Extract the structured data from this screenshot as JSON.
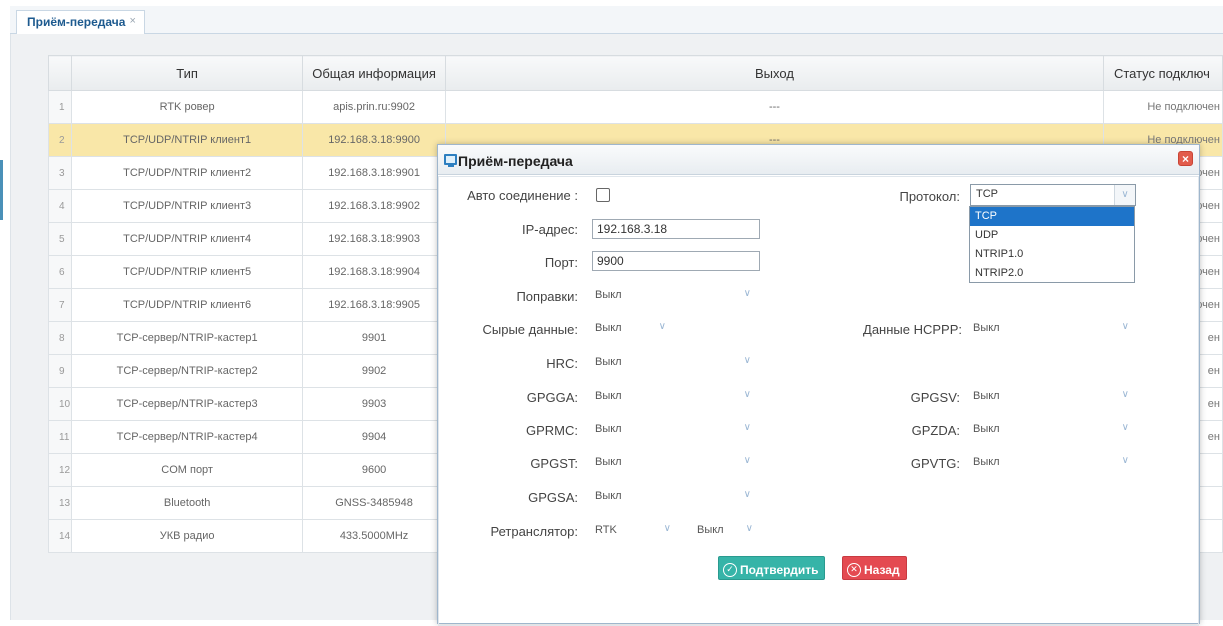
{
  "tab": {
    "label": "Приём-передача",
    "close": "×"
  },
  "table": {
    "headers": [
      "",
      "Тип",
      "Общая информация",
      "Выход",
      "Статус подключ"
    ],
    "rows": [
      {
        "num": "1",
        "type": "RTK ровер",
        "info": "apis.prin.ru:9902",
        "out": "---",
        "status": "Не подключен"
      },
      {
        "num": "2",
        "type": "TCP/UDP/NTRIP клиент1",
        "info": "192.168.3.18:9900",
        "out": "---",
        "status": "Не подключен"
      },
      {
        "num": "3",
        "type": "TCP/UDP/NTRIP клиент2",
        "info": "192.168.3.18:9901",
        "out": "",
        "status": "ючен"
      },
      {
        "num": "4",
        "type": "TCP/UDP/NTRIP клиент3",
        "info": "192.168.3.18:9902",
        "out": "",
        "status": "ючен"
      },
      {
        "num": "5",
        "type": "TCP/UDP/NTRIP клиент4",
        "info": "192.168.3.18:9903",
        "out": "",
        "status": "ючен"
      },
      {
        "num": "6",
        "type": "TCP/UDP/NTRIP клиент5",
        "info": "192.168.3.18:9904",
        "out": "",
        "status": "ючен"
      },
      {
        "num": "7",
        "type": "TCP/UDP/NTRIP клиент6",
        "info": "192.168.3.18:9905",
        "out": "",
        "status": "ючен"
      },
      {
        "num": "8",
        "type": "TCP-сервер/NTRIP-кастер1",
        "info": "9901",
        "out": "",
        "status": "ен"
      },
      {
        "num": "9",
        "type": "TCP-сервер/NTRIP-кастер2",
        "info": "9902",
        "out": "",
        "status": "ен"
      },
      {
        "num": "10",
        "type": "TCP-сервер/NTRIP-кастер3",
        "info": "9903",
        "out": "",
        "status": "ен"
      },
      {
        "num": "11",
        "type": "TCP-сервер/NTRIP-кастер4",
        "info": "9904",
        "out": "",
        "status": "ен"
      },
      {
        "num": "12",
        "type": "COM порт",
        "info": "9600",
        "out": "",
        "status": ""
      },
      {
        "num": "13",
        "type": "Bluetooth",
        "info": "GNSS-3485948",
        "out": "",
        "status": ""
      },
      {
        "num": "14",
        "type": "УКВ радио",
        "info": "433.5000MHz",
        "out": "",
        "status": ""
      }
    ]
  },
  "dialog": {
    "title": "Приём-передача",
    "close": "×",
    "auto_label": "Авто соединение :",
    "ip_label": "IP-адрес:",
    "ip_value": "192.168.3.18",
    "port_label": "Порт:",
    "port_value": "9900",
    "corr_label": "Поправки:",
    "corr_value": "Выкл",
    "raw_label": "Сырые данные:",
    "raw_value": "Выкл",
    "hcppp_label": "Данные HCPPP:",
    "hcppp_value": "Выкл",
    "hrc_label": "HRC:",
    "hrc_value": "Выкл",
    "gpgga_label": "GPGGA:",
    "gpgga_value": "Выкл",
    "gpgsv_label": "GPGSV:",
    "gpgsv_value": "Выкл",
    "gprmc_label": "GPRMC:",
    "gprmc_value": "Выкл",
    "gpzda_label": "GPZDA:",
    "gpzda_value": "Выкл",
    "gpgst_label": "GPGST:",
    "gpgst_value": "Выкл",
    "gpvtg_label": "GPVTG:",
    "gpvtg_value": "Выкл",
    "gpgsa_label": "GPGSA:",
    "gpgsa_value": "Выкл",
    "relay_label": "Ретранслятор:",
    "relay_value": "RTK",
    "relay_value2": "Выкл",
    "protocol_label": "Протокол:",
    "protocol_value": "TCP",
    "protocol_options": [
      "TCP",
      "UDP",
      "NTRIP1.0",
      "NTRIP2.0"
    ],
    "confirm": "Подтвердить",
    "back": "Назад"
  },
  "colors": {
    "selected_row": "#f9e7a8",
    "confirm_button": "#36b4a8",
    "back_button": "#e44a51",
    "dropdown_active": "#1e74c9"
  }
}
